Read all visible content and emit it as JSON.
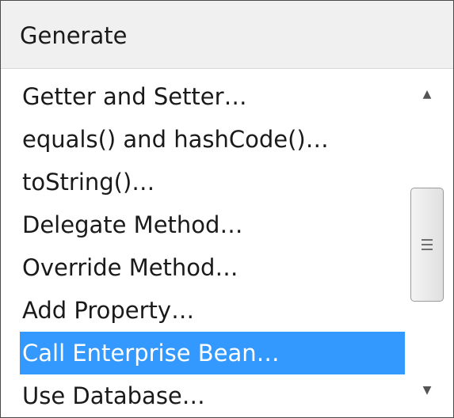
{
  "popup": {
    "title": "Generate"
  },
  "menu": {
    "items": [
      {
        "label": "Getter and Setter…",
        "selected": false
      },
      {
        "label": "equals() and hashCode()…",
        "selected": false
      },
      {
        "label": "toString()…",
        "selected": false
      },
      {
        "label": "Delegate Method…",
        "selected": false
      },
      {
        "label": "Override Method…",
        "selected": false
      },
      {
        "label": "Add Property…",
        "selected": false
      },
      {
        "label": "Call Enterprise Bean…",
        "selected": true
      },
      {
        "label": "Use Database…",
        "selected": false
      }
    ]
  },
  "scrollbar": {
    "up_icon": "▲",
    "down_icon": "▼"
  },
  "colors": {
    "selection": "#3399ff",
    "selection_text": "#ffffff",
    "border": "#4a4a4a",
    "header_bg": "#f0f0f0"
  }
}
